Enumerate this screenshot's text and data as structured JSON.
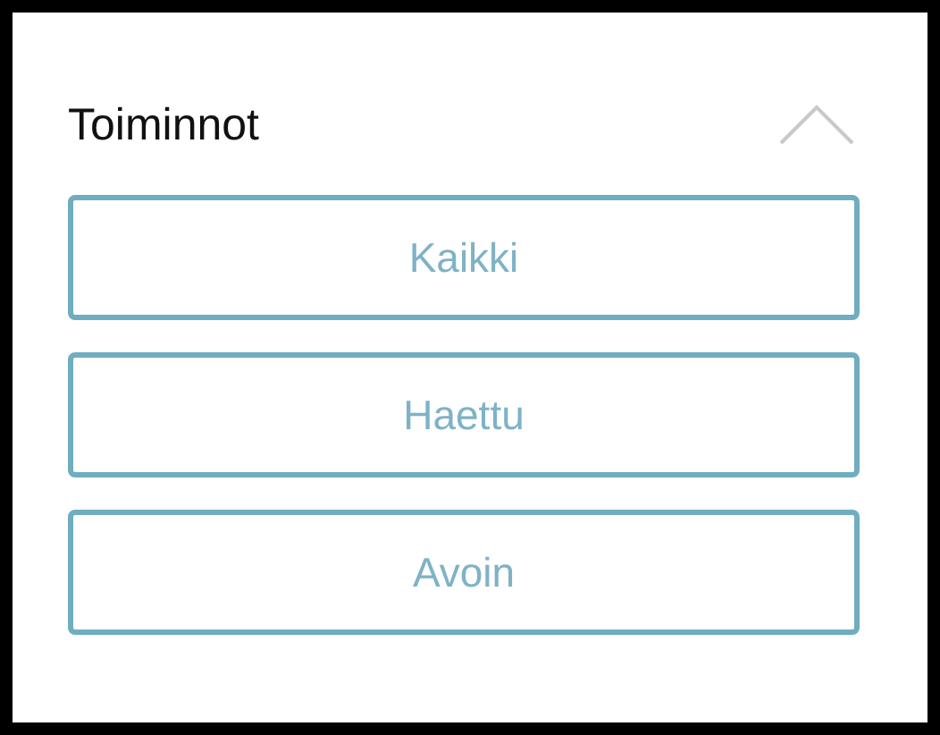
{
  "panel": {
    "title": "Toiminnot",
    "expanded": true
  },
  "buttons": [
    {
      "label": "Kaikki"
    },
    {
      "label": "Haettu"
    },
    {
      "label": "Avoin"
    }
  ]
}
